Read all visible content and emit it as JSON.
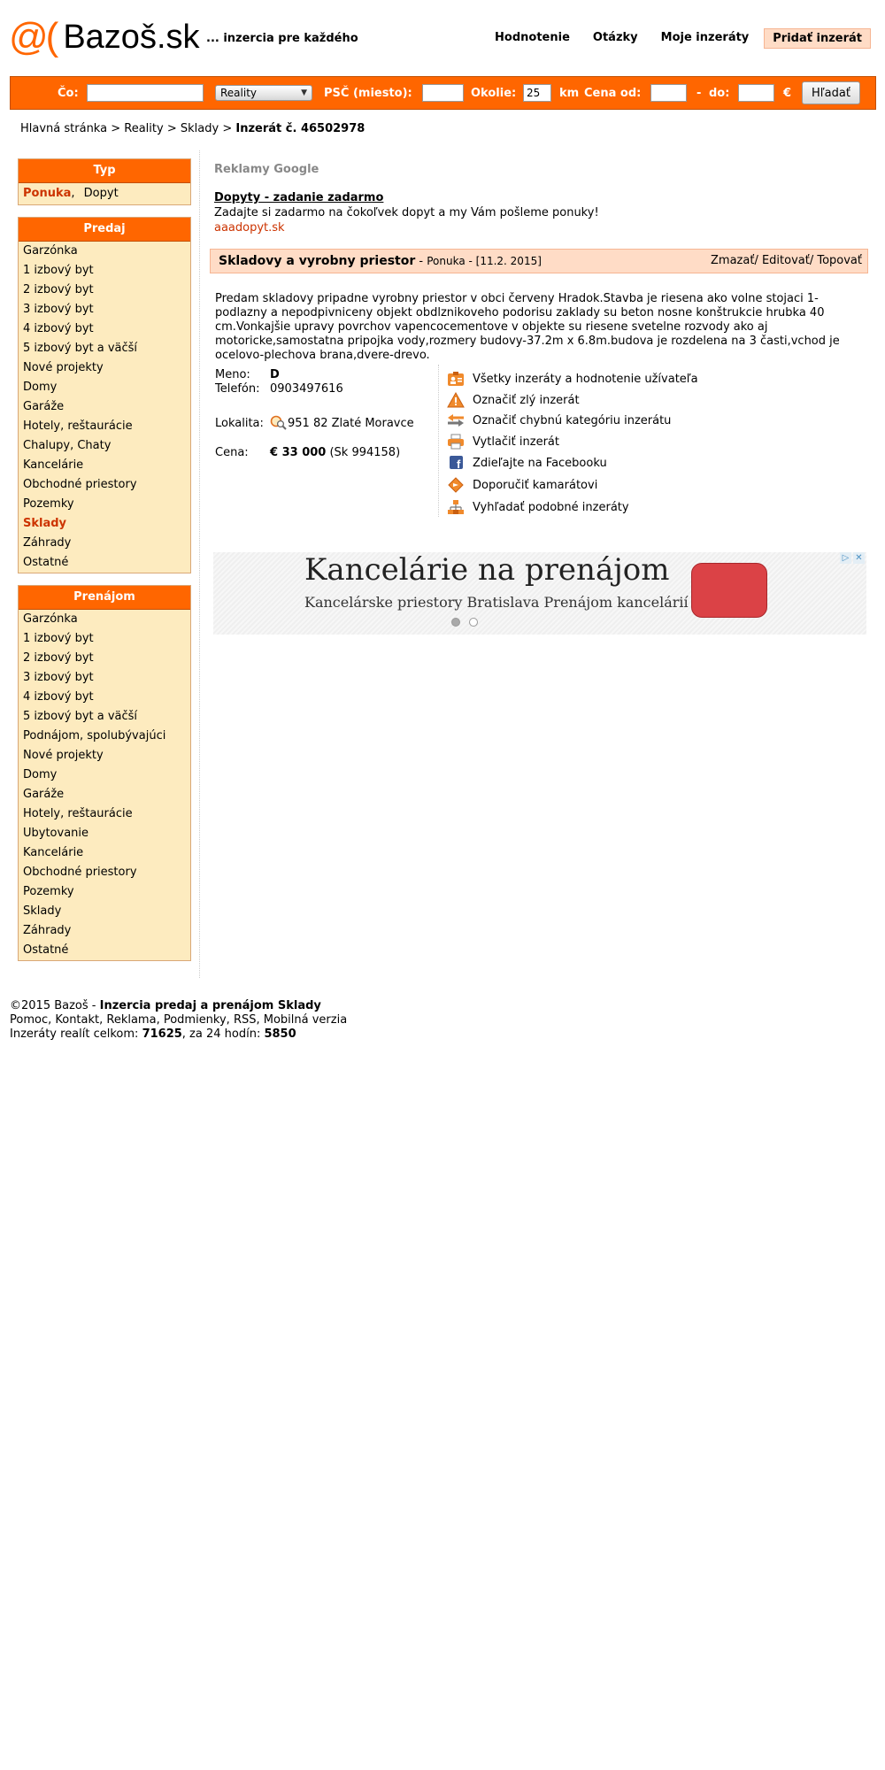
{
  "header": {
    "logo_at": "@(",
    "logo_brand": "Bazoš.sk",
    "tagline": "... inzercia pre každého",
    "nav": [
      "Hodnotenie",
      "Otázky",
      "Moje inzeráty",
      "Pridať inzerát"
    ]
  },
  "search": {
    "co_label": "Čo:",
    "co_value": "",
    "category_selected": "Reality",
    "psc_label": "PSČ (miesto):",
    "psc_value": "",
    "okolie_label": "Okolie:",
    "okolie_value": "25",
    "km_label": "km",
    "cena_od_label": "Cena od:",
    "cena_od_value": "",
    "dash": "-",
    "do_label": "do:",
    "do_value": "",
    "currency": "€",
    "submit_label": "Hľadať"
  },
  "breadcrumb": {
    "items": [
      "Hlavná stránka",
      "Reality",
      "Sklady"
    ],
    "separator": ">",
    "current": "Inzerát č. 46502978"
  },
  "sidebar": {
    "typ": {
      "title": "Typ",
      "ponuka": "Ponuka",
      "comma": ",",
      "dopyt": "Dopyt"
    },
    "predaj": {
      "title": "Predaj",
      "items": [
        "Garzónka",
        "1 izbový byt",
        "2 izbový byt",
        "3 izbový byt",
        "4 izbový byt",
        "5 izbový byt a väčší",
        "Nové projekty",
        "Domy",
        "Garáže",
        "Hotely, reštaurácie",
        "Chalupy, Chaty",
        "Kancelárie",
        "Obchodné priestory",
        "Pozemky",
        "Sklady",
        "Záhrady",
        "Ostatné"
      ],
      "selected_index": 14
    },
    "prenajom": {
      "title": "Prenájom",
      "items": [
        "Garzónka",
        "1 izbový byt",
        "2 izbový byt",
        "3 izbový byt",
        "4 izbový byt",
        "5 izbový byt a väčší",
        "Podnájom, spolubývajúci",
        "Nové projekty",
        "Domy",
        "Garáže",
        "Hotely, reštaurácie",
        "Ubytovanie",
        "Kancelárie",
        "Obchodné priestory",
        "Pozemky",
        "Sklady",
        "Záhrady",
        "Ostatné"
      ]
    }
  },
  "ads": {
    "label": "Reklamy Google",
    "title": "Dopyty - zadanie zadarmo",
    "text": "Zadajte si zadarmo na čokoľvek dopyt a my Vám pošleme ponuky!",
    "url": "aaadopyt.sk"
  },
  "listing": {
    "title": "Skladovy a vyrobny priestor",
    "meta_prefix": " - ",
    "meta": "Ponuka - [11.2. 2015]",
    "actions": "Zmazať/ Editovať/ Topovať",
    "description": "Predam skladovy pripadne vyrobny priestor v obci červeny Hradok.Stavba je riesena ako volne stojaci 1-podlazny a nepodpivniceny objekt obdlznikoveho podorisu zaklady su beton nosne konštrukcie hrubka 40 cm.Vonkajšie upravy povrchov vapencocementove v objekte su riesene svetelne rozvody ako aj motoricke,samostatna pripojka vody,rozmery budovy-37.2m x 6.8m.budova je rozdelena na 3 časti,vchod je ocelovo-plechova brana,dvere-drevo.",
    "meno_label": "Meno:",
    "meno": "D",
    "telefon_label": "Telefón:",
    "telefon": "0903497616",
    "lokalita_label": "Lokalita:",
    "lokalita": "951 82 Zlaté Moravce",
    "cena_label": "Cena:",
    "cena": "€ 33 000",
    "cena_sk": "(Sk 994158)",
    "links": [
      {
        "icon": "user-listings-icon",
        "label": "Všetky inzeráty a hodnotenie užívateľa"
      },
      {
        "icon": "warning-icon",
        "label": "Označiť zlý inzerát"
      },
      {
        "icon": "arrows-icon",
        "label": "Označiť chybnú kategóriu inzerátu"
      },
      {
        "icon": "printer-icon",
        "label": "Vytlačiť inzerát"
      },
      {
        "icon": "facebook-icon",
        "label": "Zdieľajte na Facebooku"
      },
      {
        "icon": "recommend-icon",
        "label": "Doporučiť kamarátovi"
      },
      {
        "icon": "similar-icon",
        "label": "Vyhľadať podobné inzeráty"
      }
    ]
  },
  "banner": {
    "headline": "Kancelárie na prenájom",
    "subline": "Kancelárske priestory Bratislava Prenájom kancelárií"
  },
  "footer": {
    "copy": "©2015 Bazoš - ",
    "copy_bold": "Inzercia predaj a prenájom Sklady",
    "links": "Pomoc, Kontakt, Reklama, Podmienky, RSS, Mobilná verzia",
    "stats_prefix": "Inzeráty realít celkom: ",
    "stats_total": "71625",
    "stats_mid": ", za 24 hodín: ",
    "stats_24h": "5850"
  },
  "colors": {
    "accent": "#FF6600",
    "sidebar_bg": "#FDEBBF",
    "selected": "#CC3300",
    "listing_bar": "#FFDCC6"
  }
}
